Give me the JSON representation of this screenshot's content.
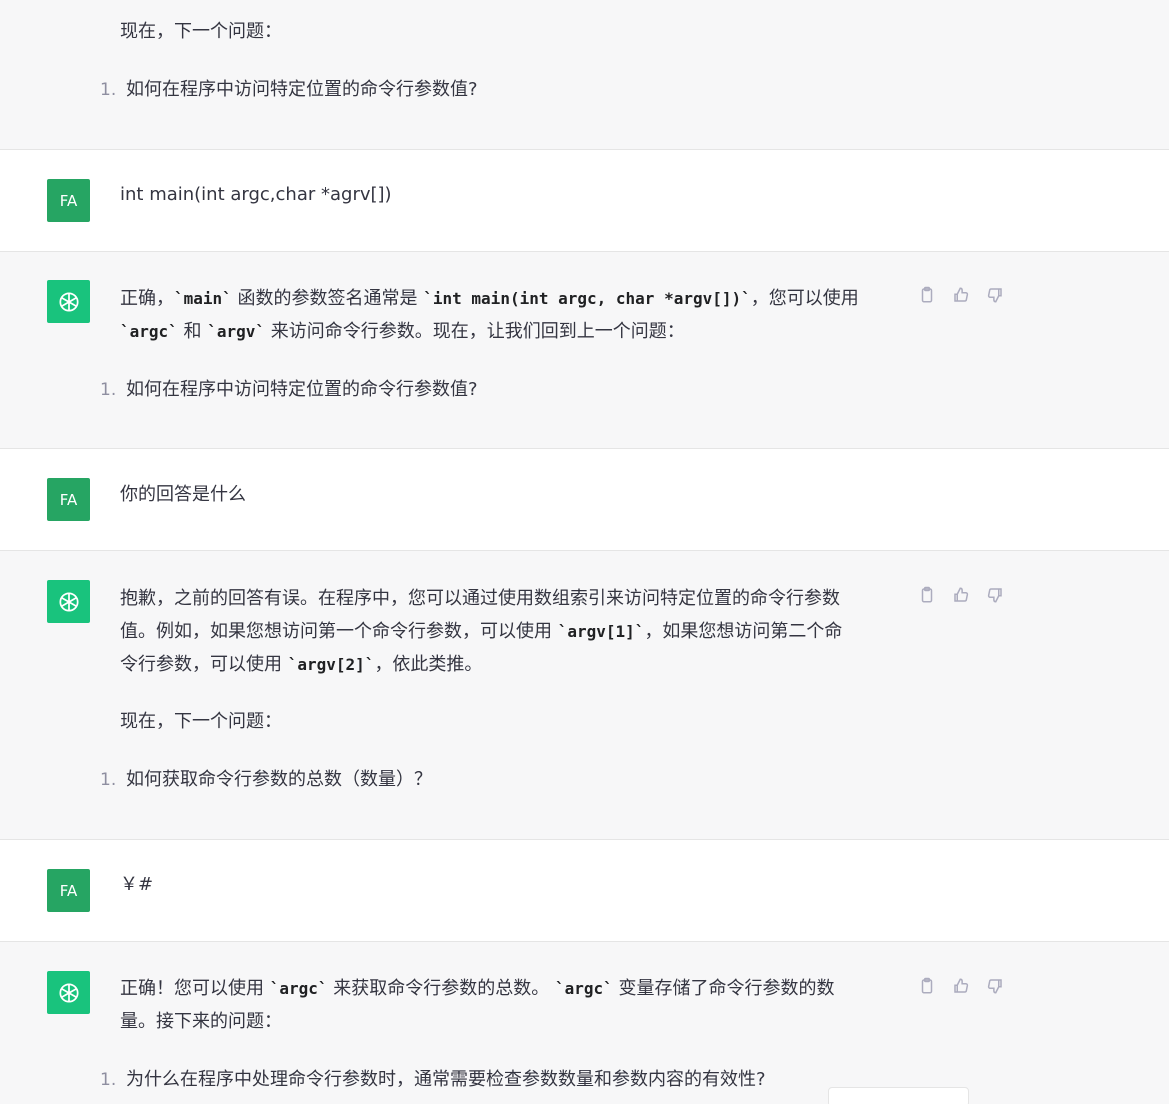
{
  "messages": [
    {
      "role": "assistant",
      "text": "现在，下一个问题：",
      "list": [
        {
          "num": "1.",
          "text": "如何在程序中访问特定位置的命令行参数值?"
        }
      ]
    },
    {
      "role": "user",
      "avatar": "FA",
      "text": "int main(int argc,char *agrv[])"
    },
    {
      "role": "assistant",
      "p1_a": "正确，",
      "p1_code1": "`main`",
      "p1_b": " 函数的参数签名通常是 ",
      "p1_code2": "`int main(int argc, char *argv[])`",
      "p1_c": "，您可以使用",
      "p2_code1": "`argc`",
      "p2_a": " 和 ",
      "p2_code2": "`argv`",
      "p2_b": " 来访问命令行参数。现在，让我们回到上一个问题：",
      "list": [
        {
          "num": "1.",
          "text": "如何在程序中访问特定位置的命令行参数值?"
        }
      ]
    },
    {
      "role": "user",
      "avatar": "FA",
      "text": "你的回答是什么"
    },
    {
      "role": "assistant",
      "l1": "抱歉，之前的回答有误。在程序中，您可以通过使用数组索引来访问特定位置的命令行参数",
      "l2_a": "值。例如，如果您想访问第一个命令行参数，可以使用 ",
      "l2_code": "`argv[1]`",
      "l2_b": "，如果您想访问第二个命",
      "l3_a": "令行参数，可以使用 ",
      "l3_code": "`argv[2]`",
      "l3_b": "，依此类推。",
      "p2": "现在，下一个问题：",
      "list": [
        {
          "num": "1.",
          "text": "如何获取命令行参数的总数（数量）？"
        }
      ]
    },
    {
      "role": "user",
      "avatar": "FA",
      "text": "￥#"
    },
    {
      "role": "assistant",
      "l1_a": "正确！您可以使用 ",
      "l1_code1": "`argc`",
      "l1_b": " 来获取命令行参数的总数。 ",
      "l1_code2": "`argc`",
      "l1_c": " 变量存储了命令行参数的数",
      "l2": "量。接下来的问题：",
      "list": [
        {
          "num": "1.",
          "text": "为什么在程序中处理命令行参数时，通常需要检查参数数量和参数内容的有效性?"
        }
      ]
    }
  ],
  "icons": {
    "copy": "clipboard-icon",
    "like": "thumbs-up-icon",
    "dislike": "thumbs-down-icon",
    "assistant_avatar": "openai-logo-icon"
  },
  "colors": {
    "user_avatar": "#26a563",
    "assistant_avatar": "#19c37d",
    "assistant_bg": "#f7f7f8"
  }
}
